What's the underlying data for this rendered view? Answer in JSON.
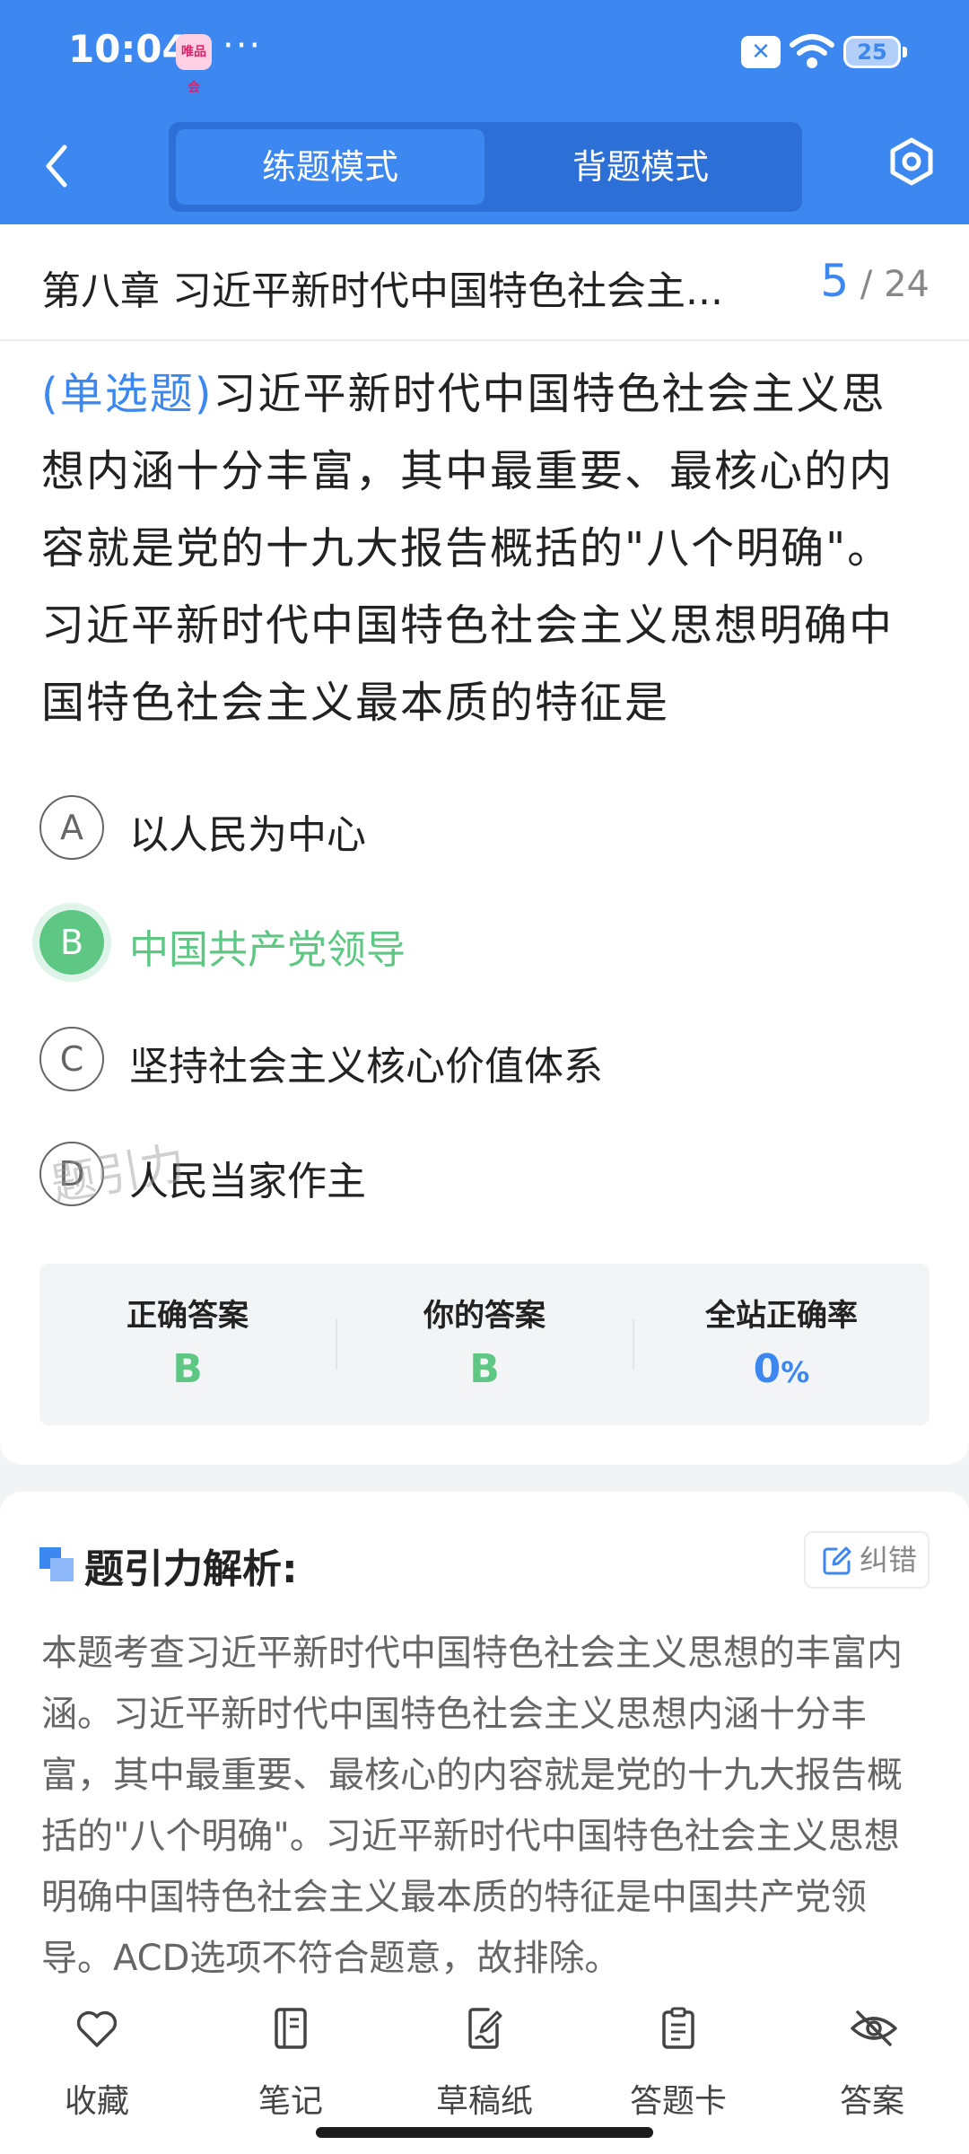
{
  "status_bar": {
    "time": "10:04",
    "app_icon_text": "唯品会",
    "dots": "···",
    "battery": "25"
  },
  "header": {
    "tabs": [
      "练题模式",
      "背题模式"
    ],
    "active_tab": "练题模式"
  },
  "chapter": {
    "title": "第八章 习近平新时代中国特色社会主...",
    "current": "5",
    "separator": "/",
    "total": "24"
  },
  "question": {
    "type": "(单选题)",
    "text": "习近平新时代中国特色社会主义思想内涵十分丰富，其中最重要、最核心的内容就是党的十九大报告概括的\"八个明确\"。习近平新时代中国特色社会主义思想明确中国特色社会主义最本质的特征是",
    "options": [
      {
        "letter": "A",
        "text": "以人民为中心"
      },
      {
        "letter": "B",
        "text": "中国共产党领导"
      },
      {
        "letter": "C",
        "text": "坚持社会主义核心价值体系"
      },
      {
        "letter": "D",
        "text": "人民当家作主"
      }
    ],
    "correct_option": "B",
    "watermark": "题引力"
  },
  "answer_panel": {
    "correct_label": "正确答案",
    "correct_value": "B",
    "your_label": "你的答案",
    "your_value": "B",
    "rate_label": "全站正确率",
    "rate_value": "0",
    "rate_unit": "%"
  },
  "analysis": {
    "title": "题引力解析:",
    "report_label": "纠错",
    "text": "本题考查习近平新时代中国特色社会主义思想的丰富内涵。习近平新时代中国特色社会主义思想内涵十分丰富，其中最重要、最核心的内容就是党的十九大报告概括的\"八个明确\"。习近平新时代中国特色社会主义思想明确中国特色社会主义最本质的特征是中国共产党领导。ACD选项不符合题意，故排除。"
  },
  "toolbar": {
    "items": [
      {
        "label": "收藏",
        "icon": "heart-icon"
      },
      {
        "label": "笔记",
        "icon": "notebook-icon"
      },
      {
        "label": "草稿纸",
        "icon": "draft-icon"
      },
      {
        "label": "答题卡",
        "icon": "answer-card-icon"
      },
      {
        "label": "答案",
        "icon": "eye-off-icon"
      }
    ]
  },
  "colors": {
    "primary": "#3d87f0",
    "correct": "#5ec784",
    "text": "#222222",
    "muted": "#666666"
  }
}
